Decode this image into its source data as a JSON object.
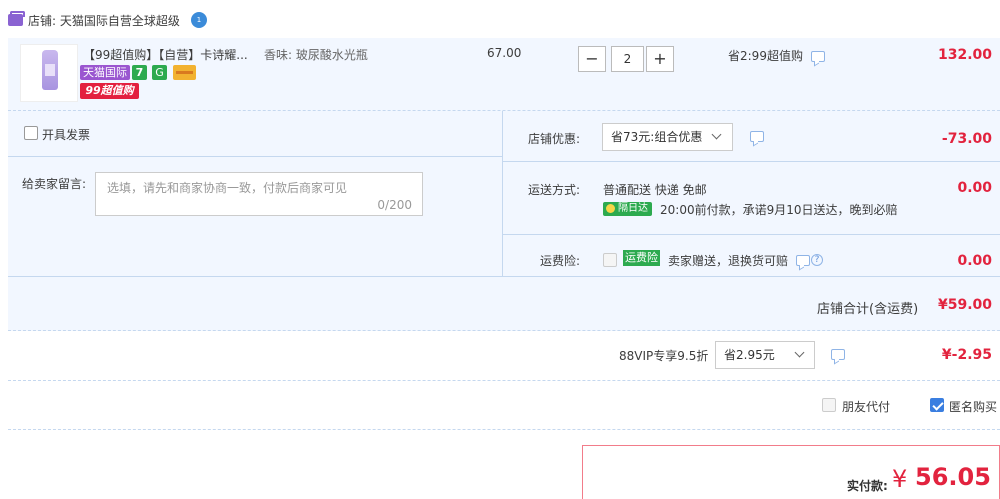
{
  "shop": {
    "label": "店铺: 天猫国际自营全球超级",
    "badge": "1"
  },
  "item": {
    "title": "【99超值购】【自营】卡诗耀...",
    "sku": "香味: 玻尿酸水光瓶",
    "tags": {
      "tmall": "天猫国际",
      "seven": "7",
      "g": "G",
      "promo": "99超值购"
    },
    "unit_price": "67.00",
    "quantity": "2",
    "minus": "−",
    "plus": "+",
    "saving": "省2:99超值购",
    "subtotal": "132.00"
  },
  "invoice": {
    "label": "开具发票"
  },
  "message": {
    "label": "给卖家留言:",
    "placeholder": "选填，请先和商家协商一致，付款后商家可见",
    "count": "0/200"
  },
  "discount": {
    "label": "店铺优惠:",
    "value": "省73元:组合优惠",
    "amount": "-73.00"
  },
  "shipping": {
    "label": "运送方式:",
    "method": "普通配送 快递 免邮",
    "badge": "隔日达",
    "promise": "20:00前付款，承诺9月10日送达，晚到必赔",
    "amount": "0.00"
  },
  "insurance": {
    "label": "运费险:",
    "tag": "运费险",
    "text": "卖家赠送，退换货可赔",
    "amount": "0.00"
  },
  "shop_total": {
    "label": "店铺合计(含运费)",
    "amount": "¥59.00"
  },
  "vip": {
    "label": "88VIP专享9.5折",
    "value": "省2.95元",
    "amount": "¥-2.95"
  },
  "options": {
    "friend_pay": "朋友代付",
    "anonymous": "匿名购买"
  },
  "payment": {
    "label": "实付款:",
    "currency": "¥",
    "amount": "56.05"
  },
  "colors": {
    "accent_red": "#e2233e",
    "panel_bg": "#f2f7ff",
    "tmall_purple": "#9a56d0",
    "green": "#2daa4f",
    "checkbox_blue": "#3a7ee0"
  }
}
